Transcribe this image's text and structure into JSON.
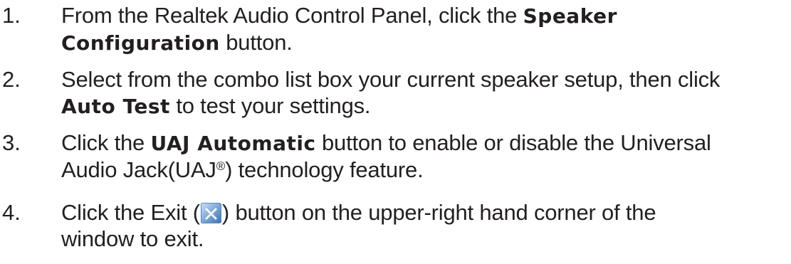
{
  "steps": [
    {
      "number": "1.",
      "line1_pre": "From the Realtek Audio Control Panel, click the ",
      "line1_bold": "Speaker",
      "line2_bold": "Configuration",
      "line2_post": " button."
    },
    {
      "number": "2.",
      "line1": "Select from the combo list box your current speaker setup, then click",
      "line2_bold": "Auto Test",
      "line2_post": " to test your settings."
    },
    {
      "number": "3.",
      "line1_pre": "Click the ",
      "line1_bold": "UAJ Automatic",
      "line1_post": " button to enable or disable the Universal",
      "line2_pre": "Audio Jack(UAJ",
      "line2_sup": "®",
      "line2_post": ") technology feature."
    },
    {
      "number": "4.",
      "line1_pre": "Click the Exit (",
      "line1_icon": "exit-x-icon",
      "line1_post": ") button on the upper-right hand corner of the",
      "line2": "window to exit."
    }
  ],
  "colors": {
    "text": "#231f20",
    "icon_blue_light": "#a9c8e8",
    "icon_blue_dark": "#4a7fb8"
  }
}
